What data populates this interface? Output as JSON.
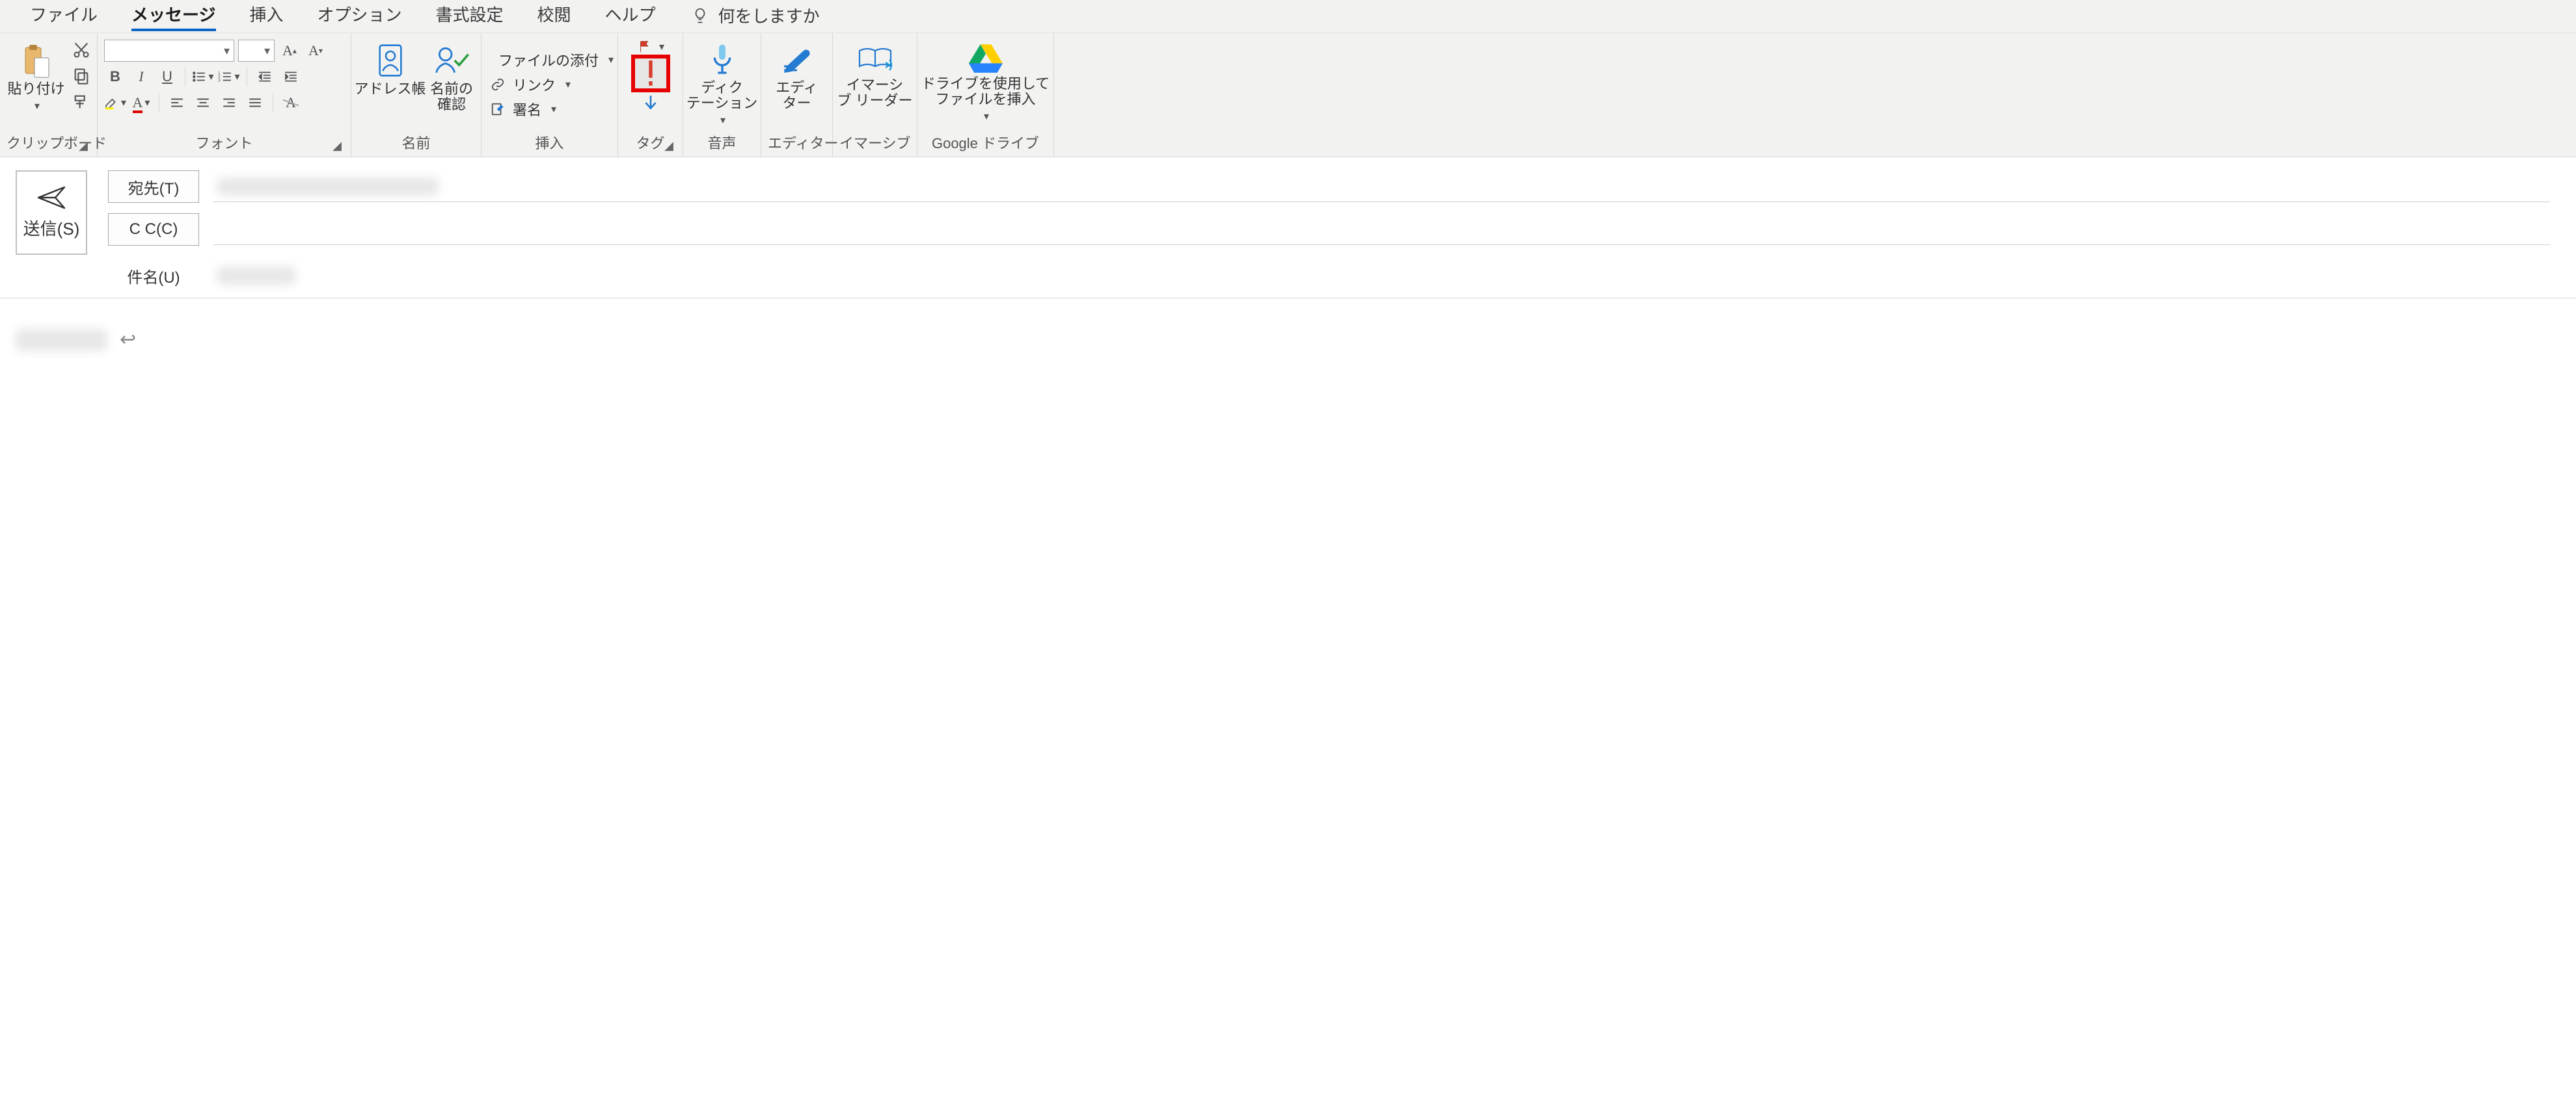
{
  "tabs": {
    "file": "ファイル",
    "message": "メッセージ",
    "insert": "挿入",
    "options": "オプション",
    "format": "書式設定",
    "review": "校閲",
    "help": "ヘルプ",
    "tell_me": "何をしますか"
  },
  "groups": {
    "clipboard": {
      "label": "クリップボード",
      "paste": "貼り付け"
    },
    "font": {
      "label": "フォント"
    },
    "names": {
      "label": "名前",
      "address_book": "アドレス帳",
      "check_names": "名前の\n確認"
    },
    "insert": {
      "label": "挿入",
      "attach_file": "ファイルの添付",
      "link": "リンク",
      "signature": "署名"
    },
    "tags": {
      "label": "タグ"
    },
    "voice": {
      "label": "音声",
      "dictate": "ディク\nテーション"
    },
    "editor": {
      "label": "エディター",
      "editor": "エディ\nター"
    },
    "immersive": {
      "label": "イマーシブ",
      "reader": "イマーシ\nブ リーダー"
    },
    "gdrive": {
      "label": "Google ドライブ",
      "insert": "ドライブを使用して\nファイルを挿入"
    }
  },
  "compose": {
    "send": "送信(S)",
    "to_btn": "宛先(T)",
    "cc_btn": "C C(C)",
    "subject_label": "件名(U)"
  },
  "body": {
    "pilcrow": "↩"
  }
}
